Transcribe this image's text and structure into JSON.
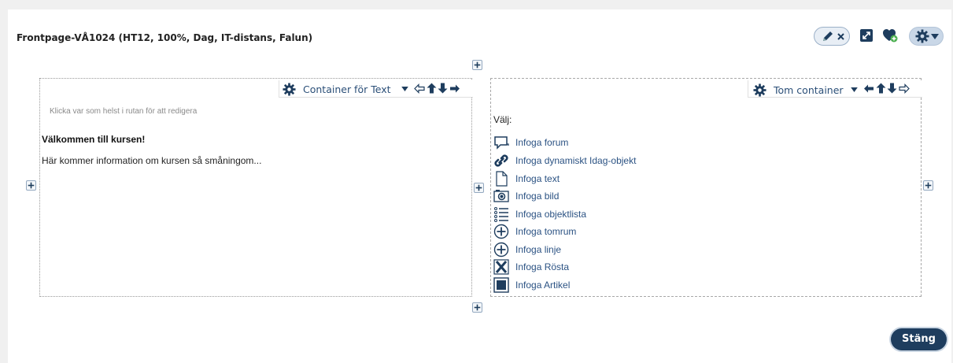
{
  "page": {
    "title": "Frontpage-VÅ1024 (HT12, 100%, Dag, IT-distans, Falun)"
  },
  "toolbar": {
    "icons": [
      "pencil-icon",
      "close-icon",
      "expand-icon",
      "heart-add-icon",
      "gear-icon",
      "dropdown-arrow-icon"
    ]
  },
  "left_container": {
    "header_label": "Container för Text",
    "hint": "Klicka var som helst i rutan för att redigera",
    "welcome": "Välkommen till kursen!",
    "info": "Här kommer information om kursen så småningom..."
  },
  "right_container": {
    "header_label": "Tom container",
    "choose_label": "Välj:",
    "items": [
      {
        "label": "Infoga forum",
        "icon": "forum-icon"
      },
      {
        "label": "Infoga dynamiskt Idag-objekt",
        "icon": "link-icon"
      },
      {
        "label": "Infoga text",
        "icon": "document-icon"
      },
      {
        "label": "Infoga bild",
        "icon": "camera-icon"
      },
      {
        "label": "Infoga objektlista",
        "icon": "list-icon"
      },
      {
        "label": "Infoga tomrum",
        "icon": "plus-circle-icon"
      },
      {
        "label": "Infoga linje",
        "icon": "plus-circle-icon"
      },
      {
        "label": "Infoga Rösta",
        "icon": "vote-icon"
      },
      {
        "label": "Infoga Artikel",
        "icon": "article-icon"
      }
    ]
  },
  "footer": {
    "close_label": "Stäng"
  },
  "colors": {
    "link": "#2b5283",
    "button_bg": "#1e3d5e",
    "pill_bg": "#c9d7e7"
  }
}
